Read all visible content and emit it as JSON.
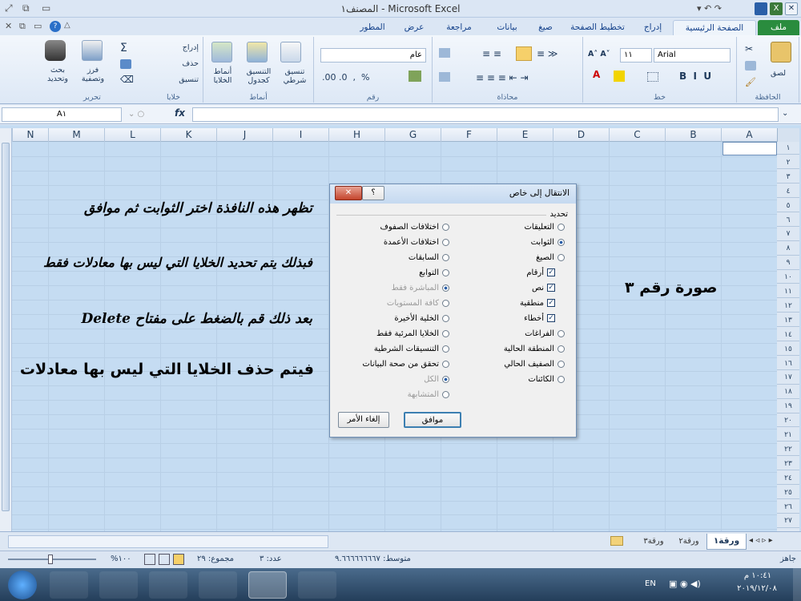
{
  "window": {
    "title": "المصنف١ - Microsoft Excel"
  },
  "tabs": [
    {
      "label": "ملف"
    },
    {
      "label": "الصفحة الرئيسية"
    },
    {
      "label": "إدراج"
    },
    {
      "label": "تخطيط الصفحة"
    },
    {
      "label": "صيغ"
    },
    {
      "label": "بيانات"
    },
    {
      "label": "مراجعة"
    },
    {
      "label": "عرض"
    },
    {
      "label": "المطور"
    }
  ],
  "ribbon": {
    "clipboard": {
      "group": "الحافظة",
      "paste": "لصق"
    },
    "font": {
      "group": "خط",
      "name": "Arial",
      "size": "١١"
    },
    "alignment": {
      "group": "محاذاة"
    },
    "number": {
      "group": "رقم",
      "format": "عام"
    },
    "styles": {
      "group": "أنماط",
      "conditional": "تنسيق شرطي",
      "as_table": "التنسيق كجدول",
      "cell_styles": "أنماط الخلايا"
    },
    "cells": {
      "group": "خلايا",
      "insert": "إدراج",
      "delete": "حذف",
      "format": "تنسيق"
    },
    "editing": {
      "group": "تحرير",
      "sort": "فرز وتصفية",
      "find": "بحث وتحديد"
    }
  },
  "formula_bar": {
    "name_box": "A١",
    "fx": "fx",
    "value": ""
  },
  "columns": [
    "A",
    "B",
    "C",
    "D",
    "E",
    "F",
    "G",
    "H",
    "I",
    "J",
    "K",
    "L",
    "M",
    "N"
  ],
  "rows": [
    "١",
    "٢",
    "٣",
    "٤",
    "٥",
    "٦",
    "٧",
    "٨",
    "٩",
    "١٠",
    "١١",
    "١٢",
    "١٣",
    "١٤",
    "١٥",
    "١٦",
    "١٧",
    "١٨",
    "١٩",
    "٢٠",
    "٢١",
    "٢٢",
    "٢٣",
    "٢٤",
    "٢٥",
    "٢٦",
    "٢٧"
  ],
  "sheet_text": {
    "image_label": "صورة رقم ٣",
    "line1": "تظهر هذه النافذة اختر الثوابت ثم موافق",
    "line2": "فبذلك يتم تحديد الخلايا التي ليس بها معادلات فقط",
    "line3": "بعد ذلك قم بالضغط على مفتاح Delete",
    "line4": "فيتم حذف الخلايا التي ليس بها معادلات"
  },
  "dialog": {
    "title": "الانتقال إلى خاص",
    "section": "تحديد",
    "right_col": [
      {
        "label": "التعليقات",
        "type": "radio",
        "on": false,
        "disabled": false
      },
      {
        "label": "الثوابت",
        "type": "radio",
        "on": true,
        "disabled": false
      },
      {
        "label": "الصيغ",
        "type": "radio",
        "on": false,
        "disabled": false
      },
      {
        "label": "أرقام",
        "type": "check",
        "on": true,
        "disabled": false
      },
      {
        "label": "نص",
        "type": "check",
        "on": true,
        "disabled": false
      },
      {
        "label": "منطقية",
        "type": "check",
        "on": true,
        "disabled": false
      },
      {
        "label": "أخطاء",
        "type": "check",
        "on": true,
        "disabled": false
      },
      {
        "label": "الفراغات",
        "type": "radio",
        "on": false,
        "disabled": false
      },
      {
        "label": "المنطقة الحالية",
        "type": "radio",
        "on": false,
        "disabled": false
      },
      {
        "label": "الصفيف الحالي",
        "type": "radio",
        "on": false,
        "disabled": false
      },
      {
        "label": "الكائنات",
        "type": "radio",
        "on": false,
        "disabled": false
      }
    ],
    "left_col": [
      {
        "label": "اختلافات الصفوف",
        "type": "radio",
        "on": false,
        "disabled": false
      },
      {
        "label": "اختلافات الأعمدة",
        "type": "radio",
        "on": false,
        "disabled": false
      },
      {
        "label": "السابقات",
        "type": "radio",
        "on": false,
        "disabled": false
      },
      {
        "label": "التوابع",
        "type": "radio",
        "on": false,
        "disabled": false
      },
      {
        "label": "المباشرة فقط",
        "type": "radio",
        "on": true,
        "disabled": true
      },
      {
        "label": "كافة المستويات",
        "type": "radio",
        "on": false,
        "disabled": true
      },
      {
        "label": "الخلية الأخيرة",
        "type": "radio",
        "on": false,
        "disabled": false
      },
      {
        "label": "الخلايا المرئية فقط",
        "type": "radio",
        "on": false,
        "disabled": false
      },
      {
        "label": "التنسيقات الشرطية",
        "type": "radio",
        "on": false,
        "disabled": false
      },
      {
        "label": "تحقق من صحة البيانات",
        "type": "radio",
        "on": false,
        "disabled": false
      },
      {
        "label": "الكل",
        "type": "radio",
        "on": true,
        "disabled": true
      },
      {
        "label": "المتشابهة",
        "type": "radio",
        "on": false,
        "disabled": true
      }
    ],
    "ok": "موافق",
    "cancel": "إلغاء الأمر",
    "help": "؟",
    "close": "✕"
  },
  "sheet_tabs": [
    "ورقة١",
    "ورقة٢",
    "ورقة٣"
  ],
  "status": {
    "ready": "جاهز",
    "average": "متوسط: ٩.٦٦٦٦٦٦٦٦٧",
    "count": "عدد: ٣",
    "sum": "مجموع: ٢٩",
    "zoom": "%١٠٠"
  },
  "taskbar": {
    "lang": "EN",
    "time": "١٠:٤١ م",
    "date": "٢٠١٩/١٢/٠٨"
  }
}
